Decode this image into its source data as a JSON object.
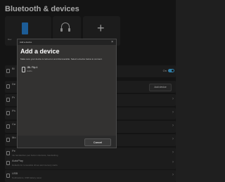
{
  "page": {
    "title": "Bluetooth & devices"
  },
  "tiles": {
    "phone_label": "Dev",
    "add_label": "+"
  },
  "rows": [
    {
      "title": "Bl",
      "sub": "",
      "toggle_text": "On"
    },
    {
      "title": "De",
      "sub": "",
      "button": "Add device"
    },
    {
      "title": "Pr",
      "sub": ""
    },
    {
      "title": "Ph",
      "sub": ""
    },
    {
      "title": "Ca",
      "sub": ""
    },
    {
      "title": "Mo",
      "sub": ""
    },
    {
      "title": "Pe",
      "sub": "Ink handwritten pen button shortcuts, handwriting"
    },
    {
      "title": "AutoPlay",
      "sub": "Defaults for removable drives and memory cards"
    },
    {
      "title": "USB",
      "sub": "Notifications, USB battery saver"
    }
  ],
  "dialog": {
    "caption": "Add a device",
    "heading": "Add a device",
    "instructions": "Make sure your device is turned on and discoverable. Select a device below to connect.",
    "device": {
      "name": "JBL Flip 4",
      "type": "Audio"
    },
    "cancel_label": "Cancel"
  }
}
